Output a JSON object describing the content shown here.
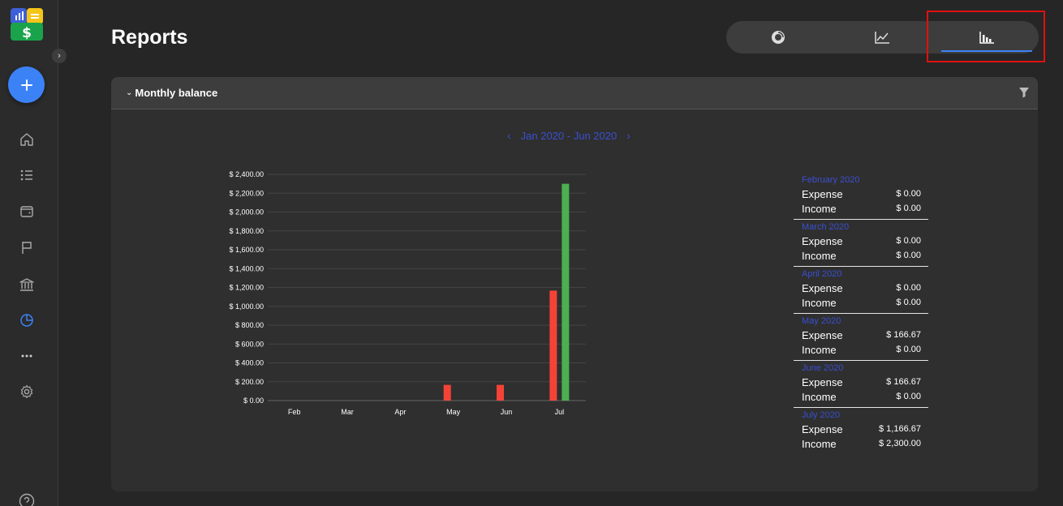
{
  "app": {
    "page_title": "Reports"
  },
  "sidebar": {
    "expand_glyph": "›",
    "items": [
      {
        "icon": "home-icon"
      },
      {
        "icon": "list-icon"
      },
      {
        "icon": "wallet-icon"
      },
      {
        "icon": "flag-icon"
      },
      {
        "icon": "bank-icon"
      },
      {
        "icon": "pie-chart-icon",
        "active": true
      },
      {
        "icon": "more-icon"
      },
      {
        "icon": "settings-icon"
      },
      {
        "icon": "help-icon"
      }
    ]
  },
  "view_switch": {
    "tabs": [
      {
        "icon": "donut-chart-icon"
      },
      {
        "icon": "line-chart-icon"
      },
      {
        "icon": "bar-chart-icon",
        "active": true
      }
    ]
  },
  "card": {
    "title": "Monthly balance",
    "collapse_glyph": "⌄",
    "period": "Jan 2020 - Jun 2020",
    "prev_glyph": "‹",
    "next_glyph": "›"
  },
  "colors": {
    "accent": "#3b82f6",
    "link": "#3a4fd1",
    "expense": "#f44336",
    "income": "#4caf50",
    "highlight": "#e01010"
  },
  "chart_data": {
    "type": "bar",
    "categories": [
      "Feb",
      "Mar",
      "Apr",
      "May",
      "Jun",
      "Jul"
    ],
    "series": [
      {
        "values": [
          0,
          0,
          0,
          166.67,
          166.67,
          1166.67
        ],
        "color": "#f44336"
      },
      {
        "values": [
          0,
          0,
          0,
          0,
          0,
          2300
        ],
        "color": "#4caf50"
      }
    ],
    "ylim": [
      0,
      2400
    ],
    "yticks": [
      0,
      200,
      400,
      600,
      800,
      1000,
      1200,
      1400,
      1600,
      1800,
      2000,
      2200,
      2400
    ],
    "ytick_labels": [
      "$ 0.00",
      "$ 200.00",
      "$ 400.00",
      "$ 600.00",
      "$ 800.00",
      "$ 1,000.00",
      "$ 1,200.00",
      "$ 1,400.00",
      "$ 1,600.00",
      "$ 1,800.00",
      "$ 2,000.00",
      "$ 2,200.00",
      "$ 2,400.00"
    ],
    "grid": true
  },
  "summary": [
    {
      "month": "February 2020",
      "expense_label": "Expense",
      "expense": "$ 0.00",
      "income_label": "Income",
      "income": "$ 0.00"
    },
    {
      "month": "March 2020",
      "expense_label": "Expense",
      "expense": "$ 0.00",
      "income_label": "Income",
      "income": "$ 0.00"
    },
    {
      "month": "April 2020",
      "expense_label": "Expense",
      "expense": "$ 0.00",
      "income_label": "Income",
      "income": "$ 0.00"
    },
    {
      "month": "May 2020",
      "expense_label": "Expense",
      "expense": "$ 166.67",
      "income_label": "Income",
      "income": "$ 0.00"
    },
    {
      "month": "June 2020",
      "expense_label": "Expense",
      "expense": "$ 166.67",
      "income_label": "Income",
      "income": "$ 0.00"
    },
    {
      "month": "July 2020",
      "expense_label": "Expense",
      "expense": "$ 1,166.67",
      "income_label": "Income",
      "income": "$ 2,300.00"
    }
  ]
}
